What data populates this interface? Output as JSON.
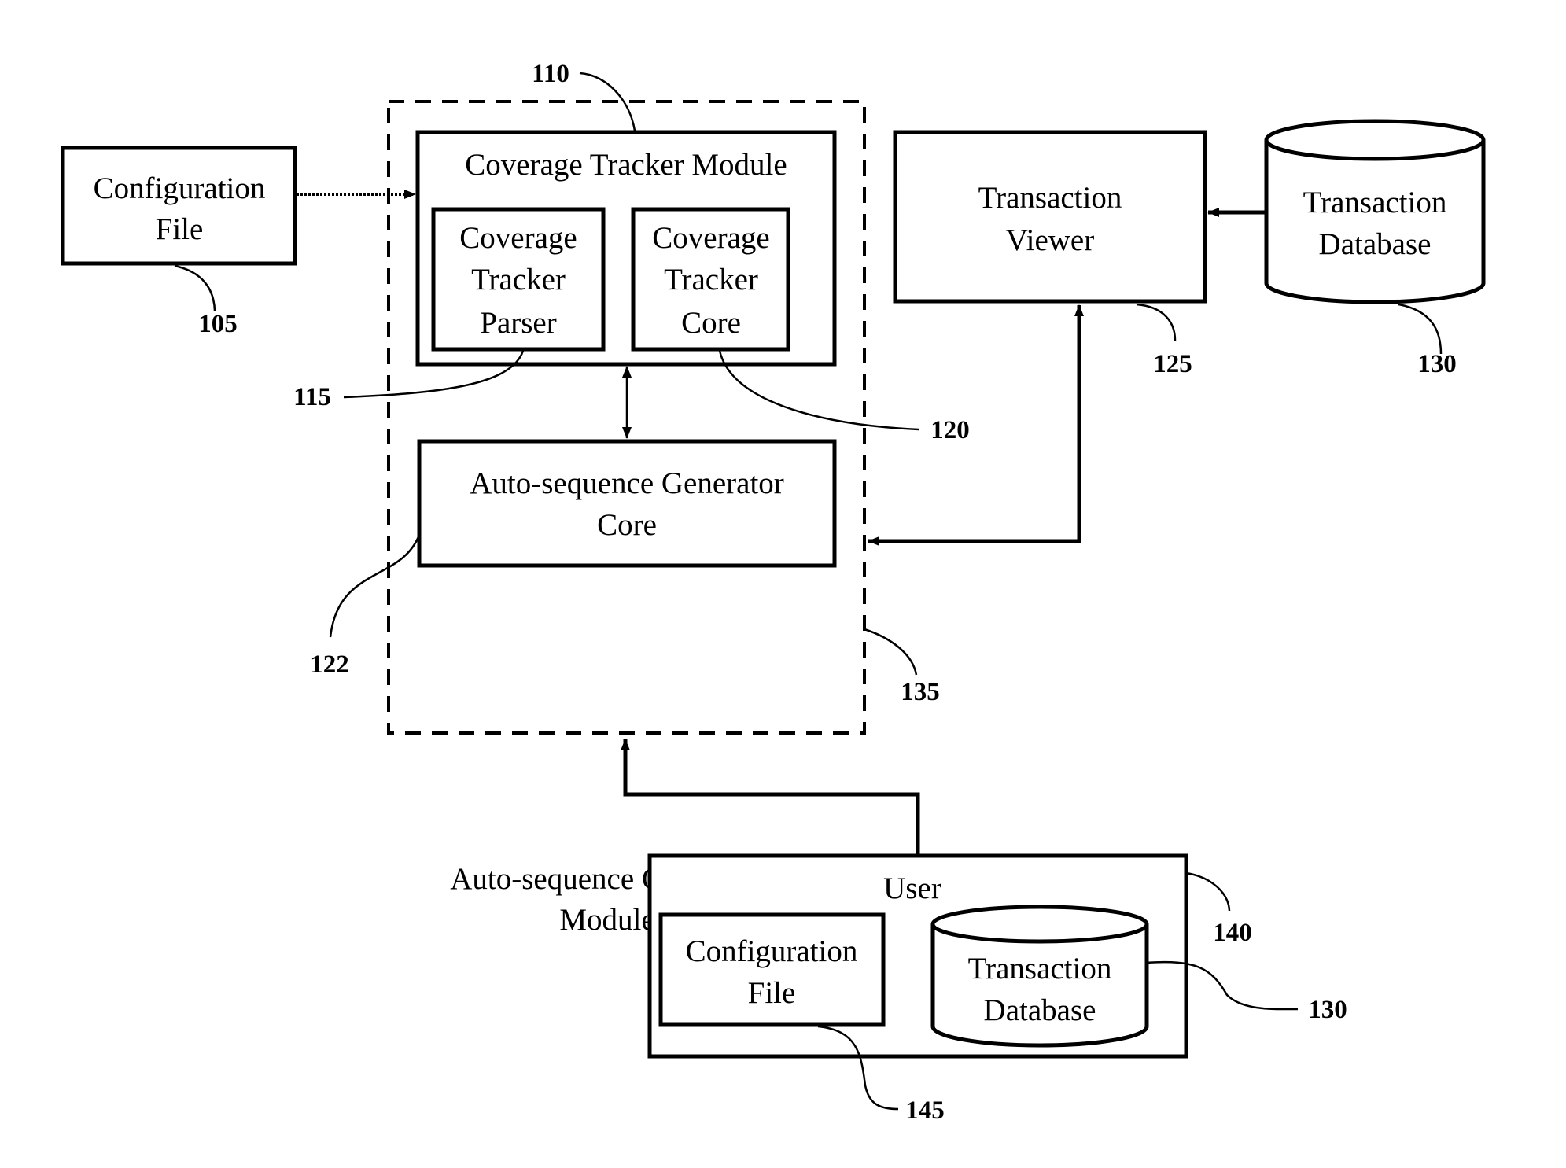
{
  "diagram": {
    "config_file": {
      "line1": "Configuration",
      "line2": "File",
      "ref": "105"
    },
    "coverage_tracker_module": {
      "title": "Coverage Tracker Module",
      "ref": "110"
    },
    "coverage_tracker_parser": {
      "line1": "Coverage",
      "line2": "Tracker",
      "line3": "Parser",
      "ref": "115"
    },
    "coverage_tracker_core": {
      "line1": "Coverage",
      "line2": "Tracker",
      "line3": "Core",
      "ref": "120"
    },
    "auto_sequence_generator_core": {
      "line1": "Auto-sequence Generator",
      "line2": "Core",
      "ref": "122"
    },
    "auto_sequence_generator_module": {
      "line1": "Auto-sequence Generator",
      "line2": "Module",
      "ref": "135"
    },
    "transaction_viewer": {
      "line1": "Transaction",
      "line2": "Viewer",
      "ref": "125"
    },
    "transaction_database": {
      "line1": "Transaction",
      "line2": "Database",
      "ref": "130"
    },
    "user": {
      "title": "User",
      "ref": "140",
      "config_file": {
        "line1": "Configuration",
        "line2": "File",
        "ref": "145"
      },
      "transaction_database": {
        "line1": "Transaction",
        "line2": "Database",
        "ref": "130"
      }
    }
  }
}
